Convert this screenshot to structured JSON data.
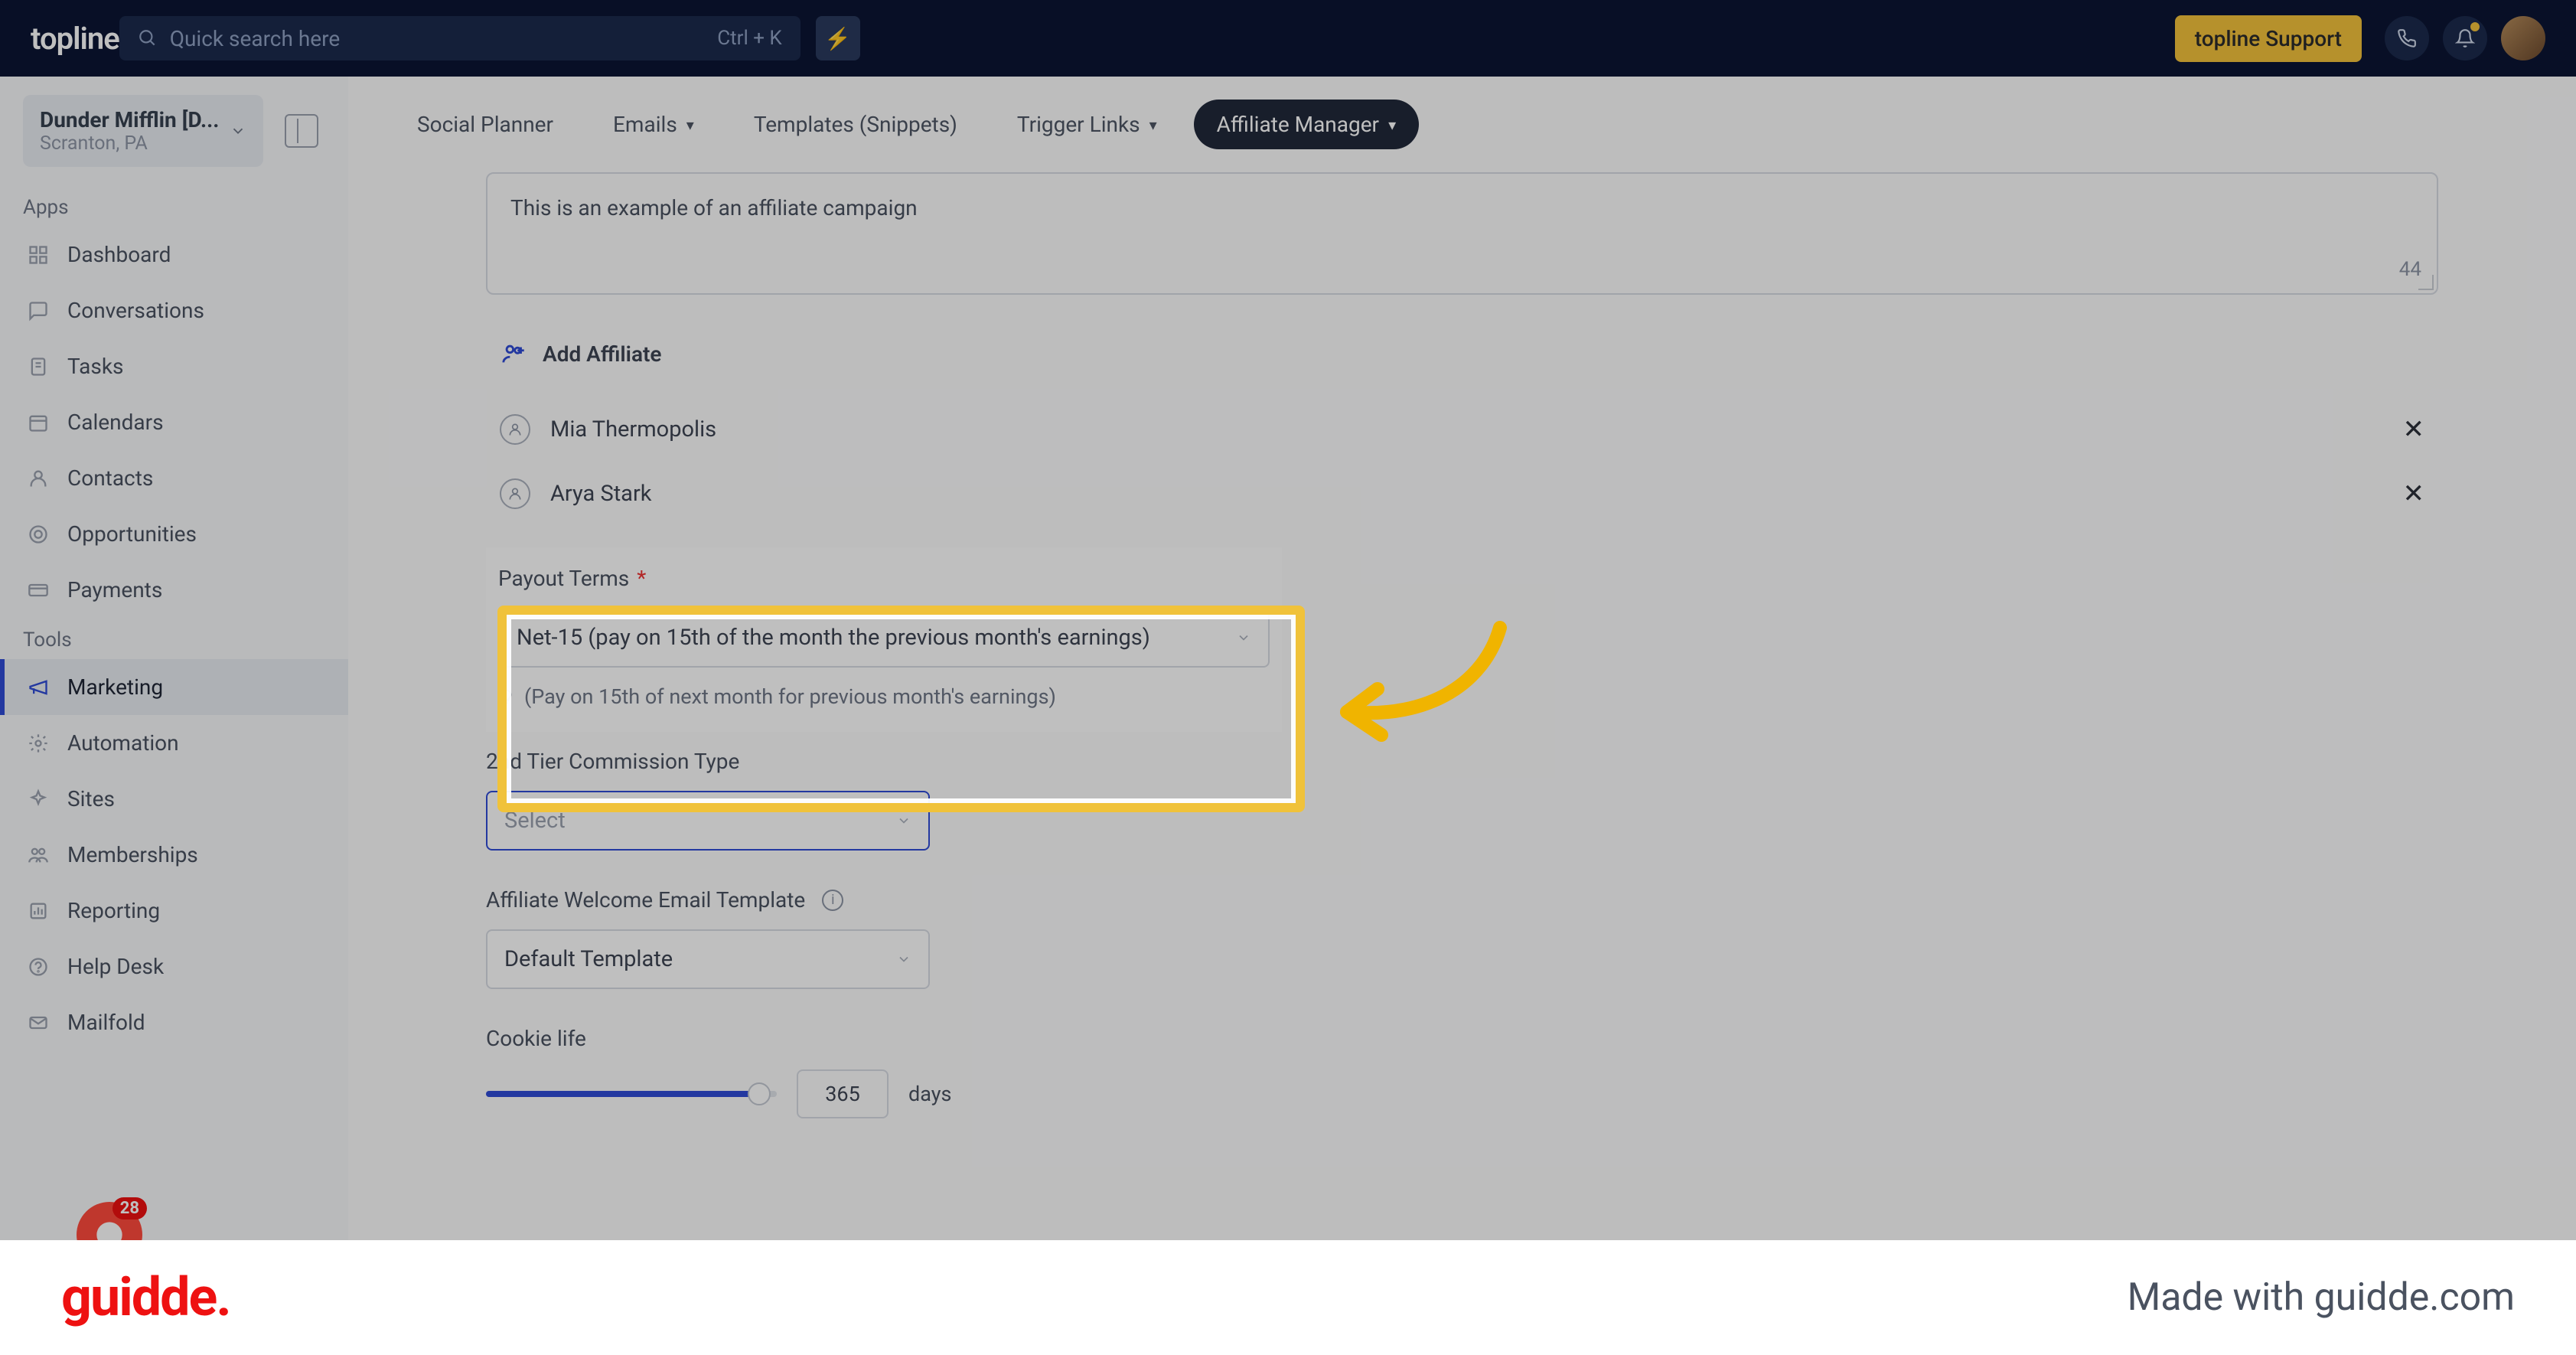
{
  "header": {
    "brand": "topline",
    "search_placeholder": "Quick search here",
    "search_shortcut": "Ctrl + K",
    "support_label": "topline Support"
  },
  "org": {
    "name": "Dunder Mifflin [D...",
    "location": "Scranton, PA"
  },
  "sidebar": {
    "sections": [
      {
        "label": "Apps",
        "items": [
          {
            "icon": "dashboard-icon",
            "label": "Dashboard"
          },
          {
            "icon": "chat-icon",
            "label": "Conversations"
          },
          {
            "icon": "tasks-icon",
            "label": "Tasks"
          },
          {
            "icon": "calendar-icon",
            "label": "Calendars"
          },
          {
            "icon": "contact-icon",
            "label": "Contacts"
          },
          {
            "icon": "target-icon",
            "label": "Opportunities"
          },
          {
            "icon": "card-icon",
            "label": "Payments"
          }
        ]
      },
      {
        "label": "Tools",
        "items": [
          {
            "icon": "megaphone-icon",
            "label": "Marketing",
            "active": true
          },
          {
            "icon": "gear-icon",
            "label": "Automation"
          },
          {
            "icon": "sparkle-icon",
            "label": "Sites"
          },
          {
            "icon": "people-icon",
            "label": "Memberships"
          },
          {
            "icon": "report-icon",
            "label": "Reporting"
          },
          {
            "icon": "help-icon",
            "label": "Help Desk"
          },
          {
            "icon": "mail-icon",
            "label": "Mailfold"
          }
        ]
      }
    ],
    "badge_count": "28"
  },
  "tabs": {
    "items": [
      {
        "label": "Social Planner"
      },
      {
        "label": "Emails",
        "chevron": true
      },
      {
        "label": "Templates (Snippets)"
      },
      {
        "label": "Trigger Links",
        "chevron": true
      },
      {
        "label": "Affiliate Manager",
        "chevron": true,
        "active": true
      }
    ]
  },
  "form": {
    "description_value": "This is an example of an affiliate campaign",
    "description_count": "44",
    "add_affiliate_label": "Add Affiliate",
    "affiliates": [
      {
        "name": "Mia Thermopolis"
      },
      {
        "name": "Arya Stark"
      }
    ],
    "payout": {
      "label": "Payout Terms",
      "value": "Net-15 (pay on 15th of the month the previous month's earnings)",
      "hint": "(Pay on 15th of next month for previous month's earnings)"
    },
    "tier2": {
      "label": "2nd Tier Commission Type",
      "placeholder": "Select"
    },
    "email_template": {
      "label": "Affiliate Welcome Email Template",
      "value": "Default Template"
    },
    "cookie": {
      "label": "Cookie life",
      "value": "365",
      "unit": "days"
    }
  },
  "footer": {
    "logo": "guidde.",
    "made_with": "Made with guidde.com"
  }
}
